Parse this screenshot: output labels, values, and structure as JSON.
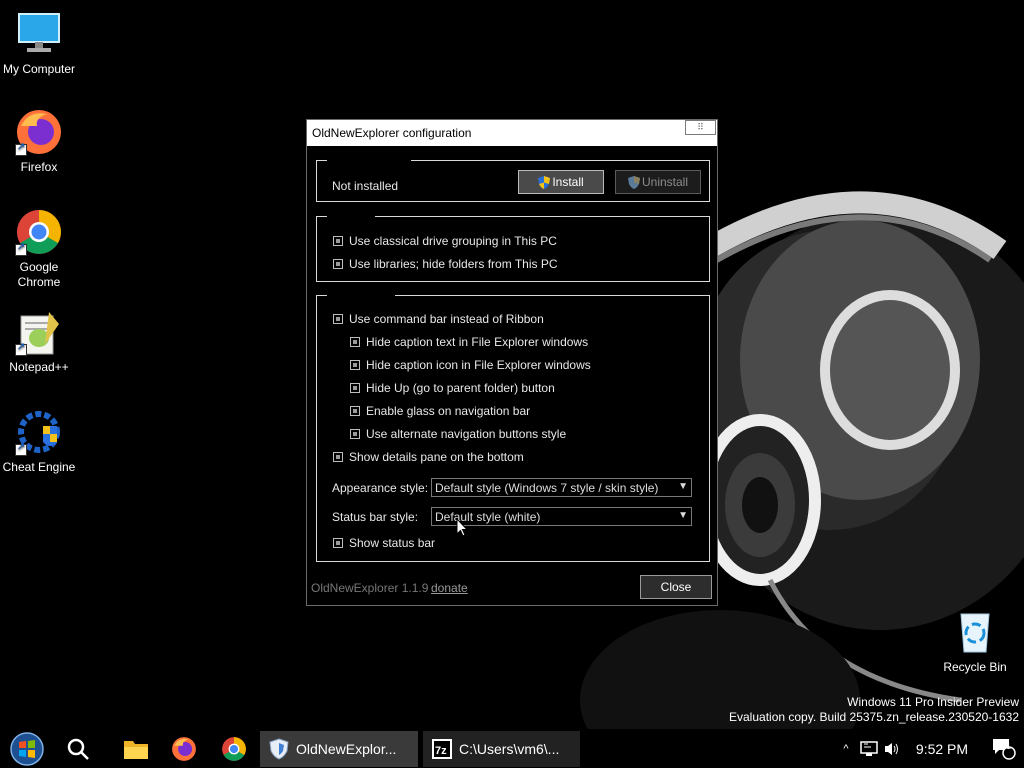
{
  "desktop": {
    "icons": [
      {
        "label": "My Computer",
        "icon": "monitor-icon"
      },
      {
        "label": "Firefox",
        "icon": "firefox-icon"
      },
      {
        "label": "Google Chrome",
        "icon": "chrome-icon"
      },
      {
        "label": "Notepad++",
        "icon": "notepadpp-icon"
      },
      {
        "label": "Cheat Engine",
        "icon": "cheat-engine-icon"
      }
    ],
    "recycle_bin": {
      "label": "Recycle Bin",
      "icon": "recycle-bin-icon"
    },
    "watermark": {
      "line1": "Windows 11 Pro Insider Preview",
      "line2": "Evaluation copy. Build 25375.zn_release.230520-1632"
    }
  },
  "dialog": {
    "title": "OldNewExplorer configuration",
    "status_text": "Not installed",
    "install_label": "Install",
    "uninstall_label": "Uninstall",
    "group_pc": {
      "options": [
        {
          "label": "Use classical drive grouping in This PC",
          "checked": true
        },
        {
          "label": "Use libraries; hide folders from This PC",
          "checked": true
        }
      ]
    },
    "group_appearance": {
      "options": [
        {
          "label": "Use command bar instead of Ribbon",
          "checked": true
        },
        {
          "label": "Hide caption text in File Explorer windows",
          "checked": true
        },
        {
          "label": "Hide caption icon in File Explorer windows",
          "checked": true
        },
        {
          "label": "Hide Up (go to parent folder) button",
          "checked": true
        },
        {
          "label": "Enable glass on navigation bar",
          "checked": true
        },
        {
          "label": "Use alternate navigation buttons style",
          "checked": true
        },
        {
          "label": "Show details pane on the bottom",
          "checked": true
        }
      ],
      "appearance_label": "Appearance style:",
      "appearance_value": "Default style (Windows 7 style / skin style)",
      "statusbar_label": "Status bar style:",
      "statusbar_value": "Default style (white)",
      "show_statusbar": {
        "label": "Show status bar",
        "checked": true
      }
    },
    "version": "OldNewExplorer 1.1.9",
    "donate": "donate",
    "close_label": "Close"
  },
  "taskbar": {
    "pinned": [
      "start-icon",
      "search-icon",
      "file-explorer-icon",
      "firefox-icon",
      "chrome-icon"
    ],
    "apps": [
      {
        "label": "OldNewExplor...",
        "icon": "oldnewexplorer-icon"
      },
      {
        "label": "C:\\Users\\vm6\\...",
        "icon": "7zip-icon"
      }
    ],
    "clock": "9:52 PM",
    "notification_count": "1"
  },
  "colors": {
    "accent": "#0078d4",
    "dialog_bg": "#000000",
    "titlebar_bg": "#ffffff"
  }
}
